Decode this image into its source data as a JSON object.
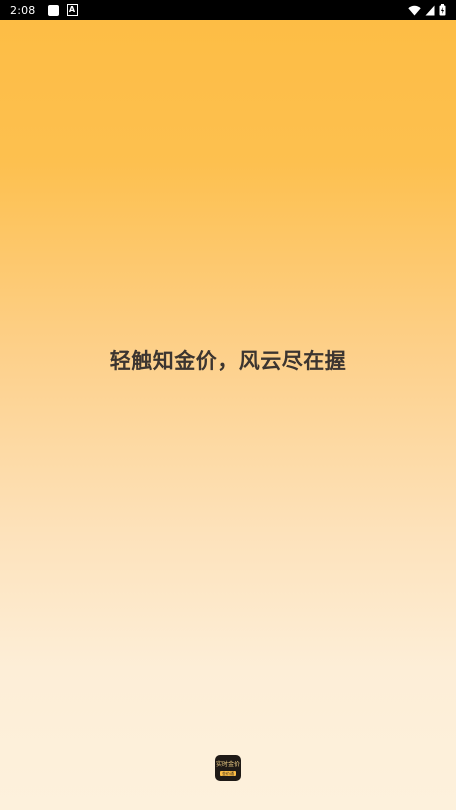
{
  "status_bar": {
    "time": "2:08",
    "notification_icons": [
      "square-notification-icon",
      "a-notification-icon"
    ],
    "notif_letter": "A",
    "system_icons": [
      "wifi-icon",
      "cellular-signal-icon",
      "battery-charging-icon"
    ]
  },
  "splash": {
    "slogan": "轻触知金价，风云尽在握",
    "app_icon": {
      "title": "实时金价",
      "sub": "金价通"
    }
  },
  "colors": {
    "gradient_top": "#fdbd45",
    "gradient_bottom": "#fdf1dc",
    "slogan_text": "#3c3530",
    "status_bar_bg": "#000000"
  }
}
